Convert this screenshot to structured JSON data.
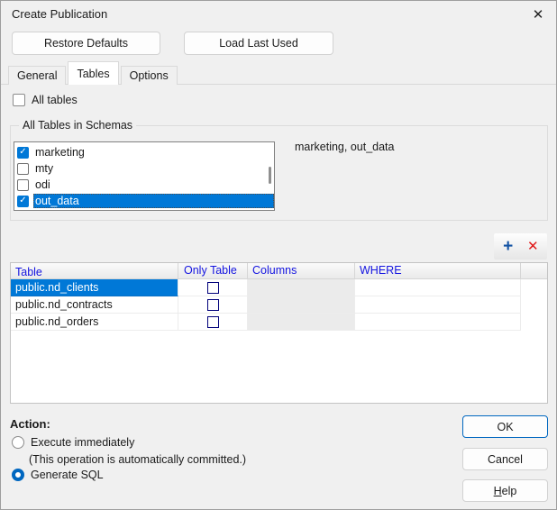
{
  "dialog": {
    "title": "Create Publication"
  },
  "icons": {
    "close": "✕",
    "add": "+",
    "delete": "✕",
    "check": "✓"
  },
  "top_buttons": {
    "restore_defaults": "Restore Defaults",
    "load_last_used": "Load Last Used"
  },
  "tabs": [
    {
      "label": "General",
      "active": false
    },
    {
      "label": "Tables",
      "active": true
    },
    {
      "label": "Options",
      "active": false
    }
  ],
  "all_tables": {
    "label": "All tables",
    "checked": false
  },
  "schemas_group": {
    "title": "All Tables in Schemas",
    "items": [
      {
        "name": "marketing",
        "checked": true,
        "selected": false
      },
      {
        "name": "mty",
        "checked": false,
        "selected": false
      },
      {
        "name": "odi",
        "checked": false,
        "selected": false
      },
      {
        "name": "out_data",
        "checked": true,
        "selected": true
      }
    ],
    "selected_summary": "marketing, out_data"
  },
  "grid": {
    "columns": [
      "Table",
      "Only Table",
      "Columns",
      "WHERE"
    ],
    "rows": [
      {
        "table": "public.nd_clients",
        "only_table": false,
        "selected": true
      },
      {
        "table": "public.nd_contracts",
        "only_table": false,
        "selected": false
      },
      {
        "table": "public.nd_orders",
        "only_table": false,
        "selected": false
      }
    ]
  },
  "action": {
    "label": "Action:",
    "options": [
      {
        "label": "Execute immediately",
        "note": "(This operation is automatically committed.)",
        "selected": false
      },
      {
        "label": "Generate SQL",
        "selected": true
      }
    ]
  },
  "footer": {
    "ok": "OK",
    "cancel": "Cancel",
    "help_mnemonic": "H",
    "help_rest": "elp"
  },
  "colors": {
    "dialog_bg": "#f0f0f0",
    "selection_blue": "#0078d7",
    "header_text_blue": "#1414e0",
    "accent_border": "#0067c0",
    "add_icon_blue": "#1353a4",
    "delete_icon_red": "#e01818",
    "grid_checkbox_navy": "#00007a"
  }
}
